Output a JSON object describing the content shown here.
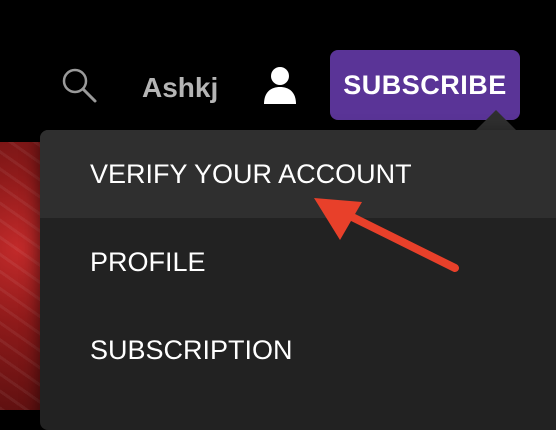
{
  "header": {
    "username": "Ashkj",
    "subscribe_label": "SUBSCRIBE",
    "icons": {
      "search": "search-icon",
      "account": "user-icon"
    }
  },
  "dropdown": {
    "items": [
      {
        "label": "VERIFY YOUR ACCOUNT",
        "highlighted": true
      },
      {
        "label": "PROFILE",
        "highlighted": false
      },
      {
        "label": "SUBSCRIPTION",
        "highlighted": false
      }
    ]
  },
  "annotation": {
    "type": "arrow",
    "points_to": "VERIFY YOUR ACCOUNT"
  },
  "colors": {
    "brand_purple": "#5a3497",
    "annotation_red": "#e8402a",
    "menu_bg": "#222222",
    "menu_highlight_bg": "#2f2f2f",
    "header_bg": "#000000"
  }
}
